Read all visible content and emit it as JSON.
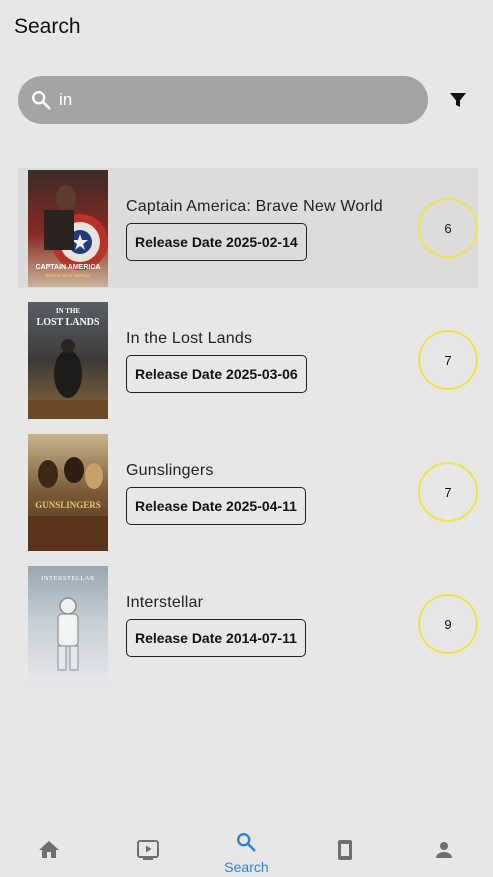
{
  "header": {
    "title": "Search"
  },
  "search": {
    "value": "in",
    "placeholder": ""
  },
  "results": [
    {
      "title": "Captain America: Brave New World",
      "release": "Release Date 2025-02-14",
      "rating": "6",
      "poster_text": "CAPTAIN AMERICA",
      "poster_subtext": "BRAVE NEW WORLD"
    },
    {
      "title": "In the Lost Lands",
      "release": "Release Date 2025-03-06",
      "rating": "7",
      "poster_text": "IN THE",
      "poster_subtext": "LOST LANDS"
    },
    {
      "title": "Gunslingers",
      "release": "Release Date 2025-04-11",
      "rating": "7",
      "poster_text": "GUNSLINGERS",
      "poster_subtext": ""
    },
    {
      "title": "Interstellar",
      "release": "Release Date 2014-07-11",
      "rating": "9",
      "poster_text": "INTERSTELLAR",
      "poster_subtext": ""
    }
  ],
  "bottom_nav": {
    "items": [
      {
        "icon": "home-icon",
        "label": ""
      },
      {
        "icon": "play-screen-icon",
        "label": ""
      },
      {
        "icon": "search-icon",
        "label": "Search"
      },
      {
        "icon": "book-icon",
        "label": ""
      },
      {
        "icon": "person-icon",
        "label": ""
      }
    ]
  },
  "colors": {
    "background": "#e7e7e7",
    "search_bar": "#a4a4a4",
    "rating_ring": "#f3e24a",
    "active_nav": "#2e86cf",
    "inactive_nav": "#6f6f6f"
  }
}
